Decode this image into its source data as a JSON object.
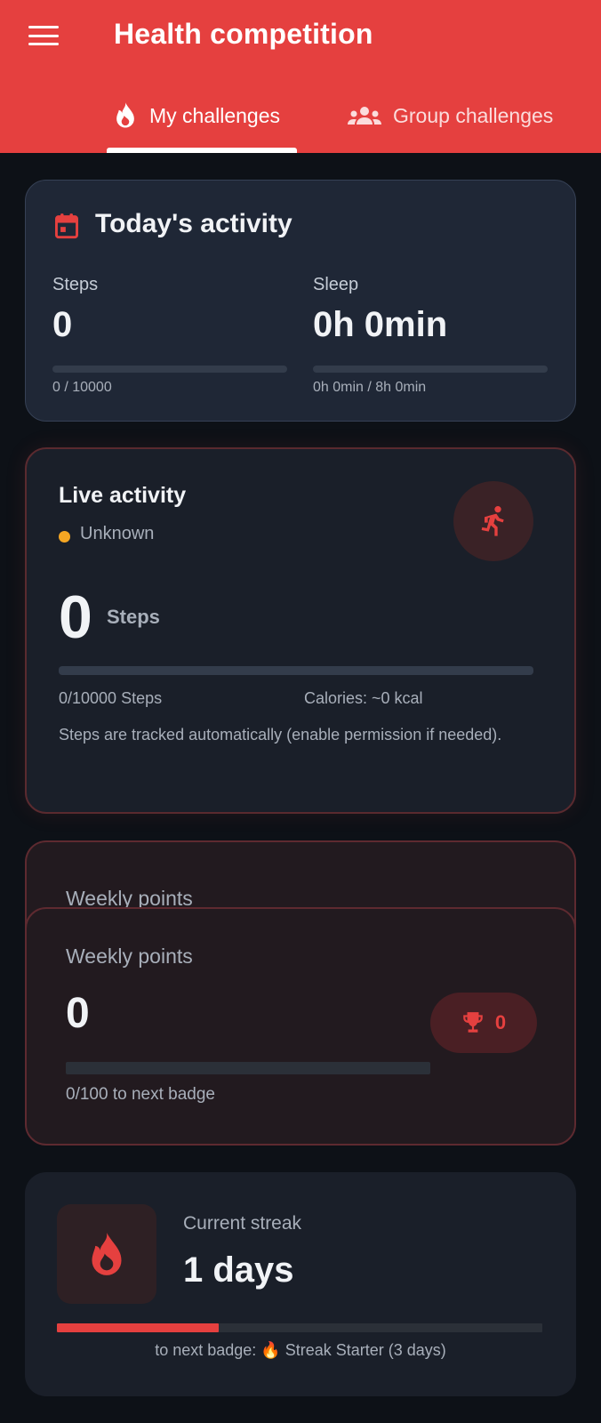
{
  "header": {
    "title": "Health competition",
    "tabs": [
      {
        "label": "My challenges",
        "icon": "flame-icon",
        "active": true
      },
      {
        "label": "Group challenges",
        "icon": "group-icon",
        "active": false
      }
    ]
  },
  "today": {
    "title": "Today's activity",
    "steps": {
      "label": "Steps",
      "value": "0",
      "progress_text": "0 / 10000",
      "progress": 0
    },
    "sleep": {
      "label": "Sleep",
      "value": "0h 0min",
      "progress_text": "0h 0min / 8h 0min",
      "progress": 0
    }
  },
  "live": {
    "title": "Live activity",
    "status": "Unknown",
    "steps_value": "0",
    "steps_unit": "Steps",
    "progress": 0,
    "steps_progress": "0/10000 Steps",
    "calories": "Calories: ~0 kcal",
    "note": "Steps are tracked automatically (enable permission if needed)."
  },
  "weekly": {
    "label_back": "Weekly points",
    "label": "Weekly points",
    "points": "0",
    "progress": 0,
    "badge_count": "0",
    "next_badge": "0/100 to next badge"
  },
  "streak": {
    "label": "Current streak",
    "value": "1 days",
    "progress": 0.333,
    "next_badge": "to next badge: 🔥 Streak Starter (3 days)"
  },
  "colors": {
    "accent": "#e5403f",
    "background": "#0d1117",
    "status_dot": "#f5a623"
  }
}
